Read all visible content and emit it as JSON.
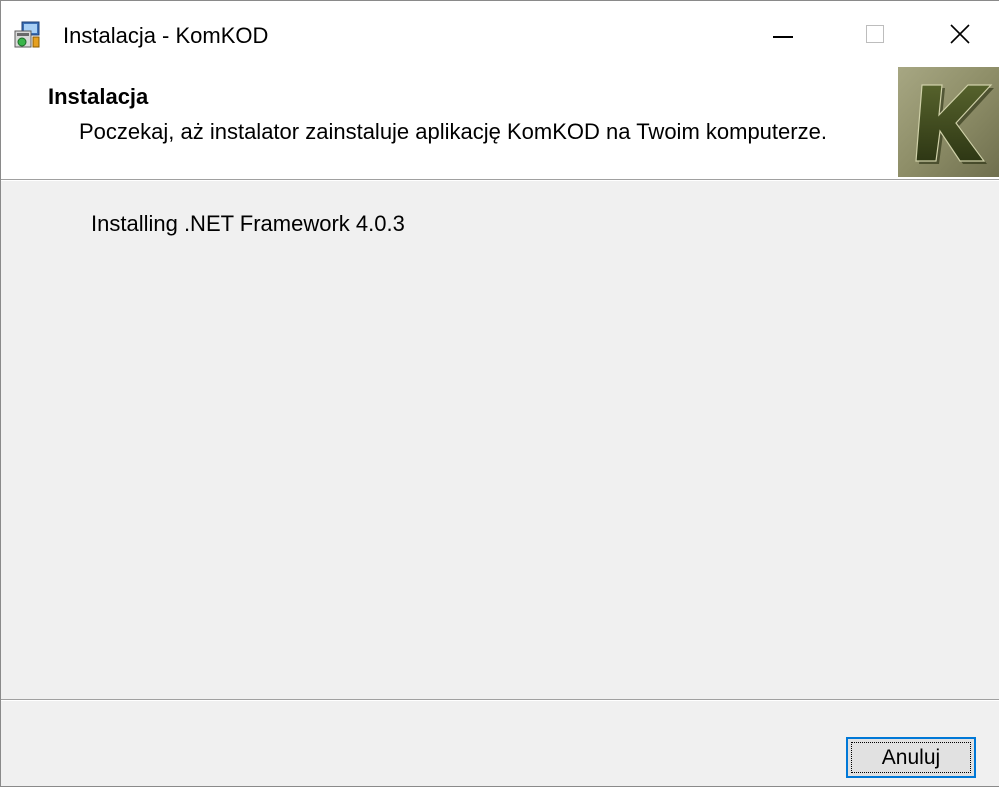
{
  "window": {
    "title": "Instalacja - KomKOD",
    "icon": "installer-icon",
    "controls": {
      "minimize": "minimize-icon",
      "maximize": "maximize-icon",
      "close": "close-icon"
    }
  },
  "header": {
    "title": "Instalacja",
    "description": "Poczekaj, aż instalator zainstaluje aplikację KomKOD na Twoim komputerze.",
    "logo": {
      "letter": "K",
      "colors": {
        "background": "#8a8a62",
        "letter": "#3f4a1c"
      }
    }
  },
  "main": {
    "status": "Installing .NET Framework 4.0.3"
  },
  "footer": {
    "cancel_label": "Anuluj"
  },
  "colors": {
    "accent": "#0078d7",
    "dialog_bg": "#f0f0f0",
    "header_bg": "#ffffff"
  }
}
